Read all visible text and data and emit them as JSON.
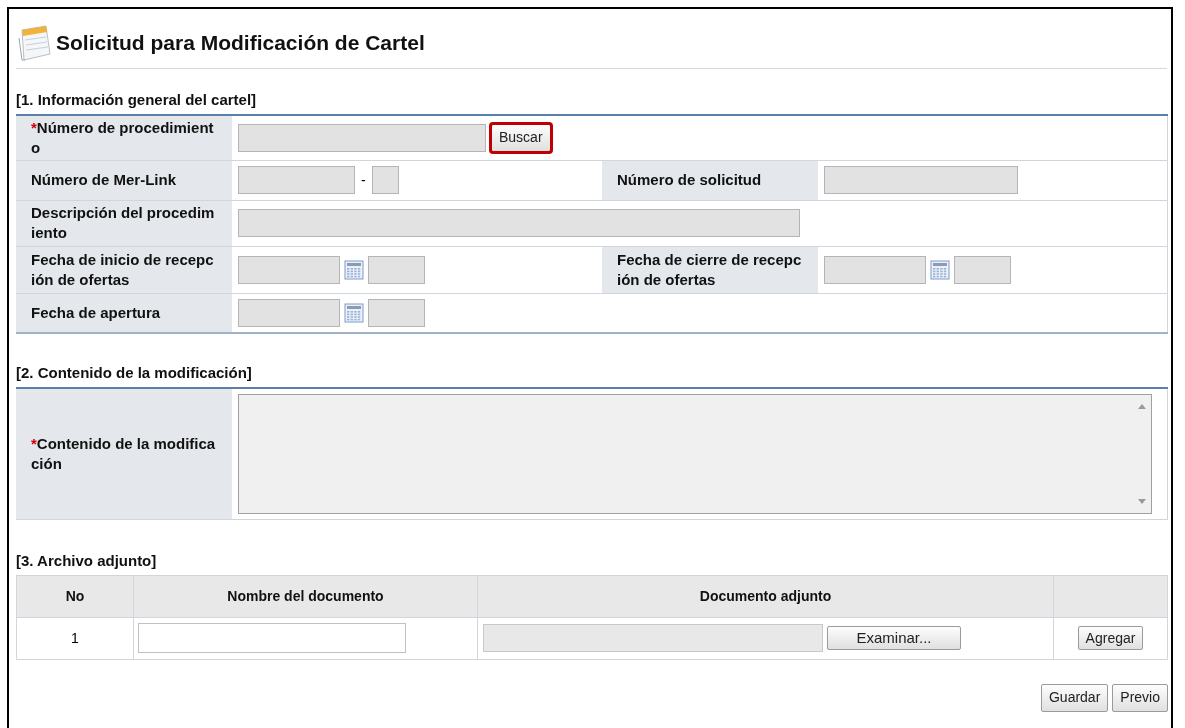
{
  "title": "Solicitud para Modificación de Cartel",
  "section1": {
    "heading": "[1. Información general del cartel]",
    "procedure_number": {
      "label": "Número de procedimiento",
      "required_mark": "*",
      "button": {
        "label": "Buscar",
        "highlighted": true
      }
    },
    "merlink_number": {
      "label": "Número de Mer-Link",
      "separator": "-"
    },
    "request_number": {
      "label": "Número de solicitud"
    },
    "description": {
      "label": "Descripción del procedimiento"
    },
    "start_date": {
      "label": "Fecha de inicio de recepción de ofertas"
    },
    "close_date": {
      "label": "Fecha de cierre de recepción de ofertas"
    },
    "opening_date": {
      "label": "Fecha de apertura"
    }
  },
  "section2": {
    "heading": "[2. Contenido de la modificación]",
    "content": {
      "label": "Contenido de la modificación",
      "required_mark": "*"
    }
  },
  "section3": {
    "heading": "[3. Archivo adjunto]",
    "columns": [
      "No",
      "Nombre del documento",
      "Documento adjunto"
    ],
    "rows": [
      {
        "no": "1",
        "browse_button": "Examinar...",
        "add_button": "Agregar"
      }
    ]
  },
  "buttons": [
    "Guardar",
    "Previo"
  ]
}
